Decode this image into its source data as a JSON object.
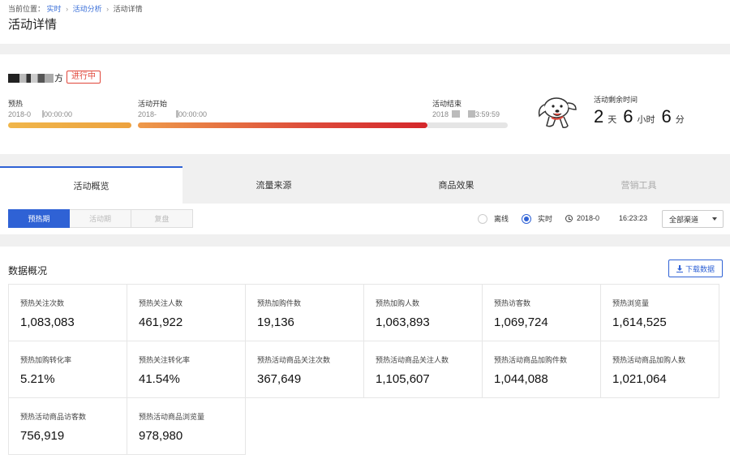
{
  "header": {
    "breadcrumb": {
      "prefix": "当前位置：",
      "items": [
        "实时",
        "活动分析",
        "活动详情"
      ]
    },
    "title": "活动详情"
  },
  "activity": {
    "name_suffix": "方",
    "status": "进行中",
    "phases": {
      "preheat": {
        "label": "预热",
        "date_a": "2018-0",
        "date_b": "00:00:00"
      },
      "start": {
        "label": "活动开始",
        "date_a": "2018-",
        "date_b": "00:00:00"
      },
      "end": {
        "label": "活动结束",
        "date_a": "2018",
        "date_b": "3:59:59"
      }
    },
    "progress": {
      "preheat": 1.0,
      "activity": 1.0,
      "ending": 0.0
    },
    "countdown": {
      "label": "活动剩余时间",
      "days": "2",
      "days_unit": "天",
      "hours": "6",
      "hours_unit": "小时",
      "minutes": "6",
      "minutes_unit": "分"
    },
    "mascot_icon": "dog-mascot-icon"
  },
  "tabs": [
    {
      "label": "活动概览",
      "active": true
    },
    {
      "label": "流量来源",
      "active": false
    },
    {
      "label": "商品效果",
      "active": false
    },
    {
      "label": "营销工具",
      "active": false,
      "disabled": true
    }
  ],
  "toolbar": {
    "periods": [
      "预热期",
      "活动期",
      "复盘"
    ],
    "active_period": "预热期",
    "modes": [
      "离线",
      "实时"
    ],
    "selected_mode": "实时",
    "date": "2018-0",
    "time": "16:23:23",
    "channel": "全部渠道"
  },
  "overview": {
    "title": "数据概况",
    "download_label": "下载数据",
    "metrics": [
      {
        "label": "预热关注次数",
        "value": "1,083,083"
      },
      {
        "label": "预热关注人数",
        "value": "461,922"
      },
      {
        "label": "预热加购件数",
        "value": "19,136"
      },
      {
        "label": "预热加购人数",
        "value": "1,063,893"
      },
      {
        "label": "预热访客数",
        "value": "1,069,724"
      },
      {
        "label": "预热浏览量",
        "value": "1,614,525"
      },
      {
        "label": "预热加购转化率",
        "value": "5.21%"
      },
      {
        "label": "预热关注转化率",
        "value": "41.54%"
      },
      {
        "label": "预热活动商品关注次数",
        "value": "367,649"
      },
      {
        "label": "预热活动商品关注人数",
        "value": "1,105,607"
      },
      {
        "label": "预热活动商品加购件数",
        "value": "1,044,088"
      },
      {
        "label": "预热活动商品加购人数",
        "value": "1,021,064"
      },
      {
        "label": "预热活动商品访客数",
        "value": "756,919"
      },
      {
        "label": "预热活动商品浏览量",
        "value": "978,980"
      }
    ]
  },
  "colors": {
    "accent": "#2f62d5",
    "status": "#e0463a"
  }
}
